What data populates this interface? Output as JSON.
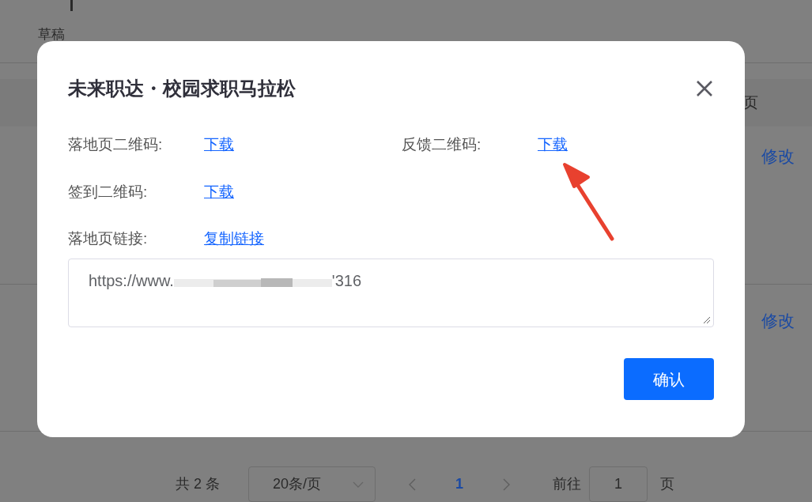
{
  "background": {
    "status_tab": "草稿",
    "column_header_tail": "页",
    "row_actions": [
      "修改",
      "修改"
    ],
    "pagination": {
      "total": "共 2 条",
      "page_size": "20条/页",
      "pages": [
        {
          "label": "1",
          "selected": true
        }
      ],
      "goto_label": "前往",
      "goto_value": "1",
      "goto_suffix": "页"
    }
  },
  "dialog": {
    "title": "未来职达・校园求职马拉松",
    "qr_links": [
      {
        "label": "落地页二维码:",
        "link": "下载"
      },
      {
        "label": "反馈二维码:",
        "link": "下载"
      },
      {
        "label": "签到二维码:",
        "link": "下载"
      }
    ],
    "link_row": {
      "label": "落地页链接:",
      "link": "复制链接"
    },
    "url": {
      "prefix": "https://www.",
      "suffix": "'316"
    },
    "confirm": "确认"
  }
}
